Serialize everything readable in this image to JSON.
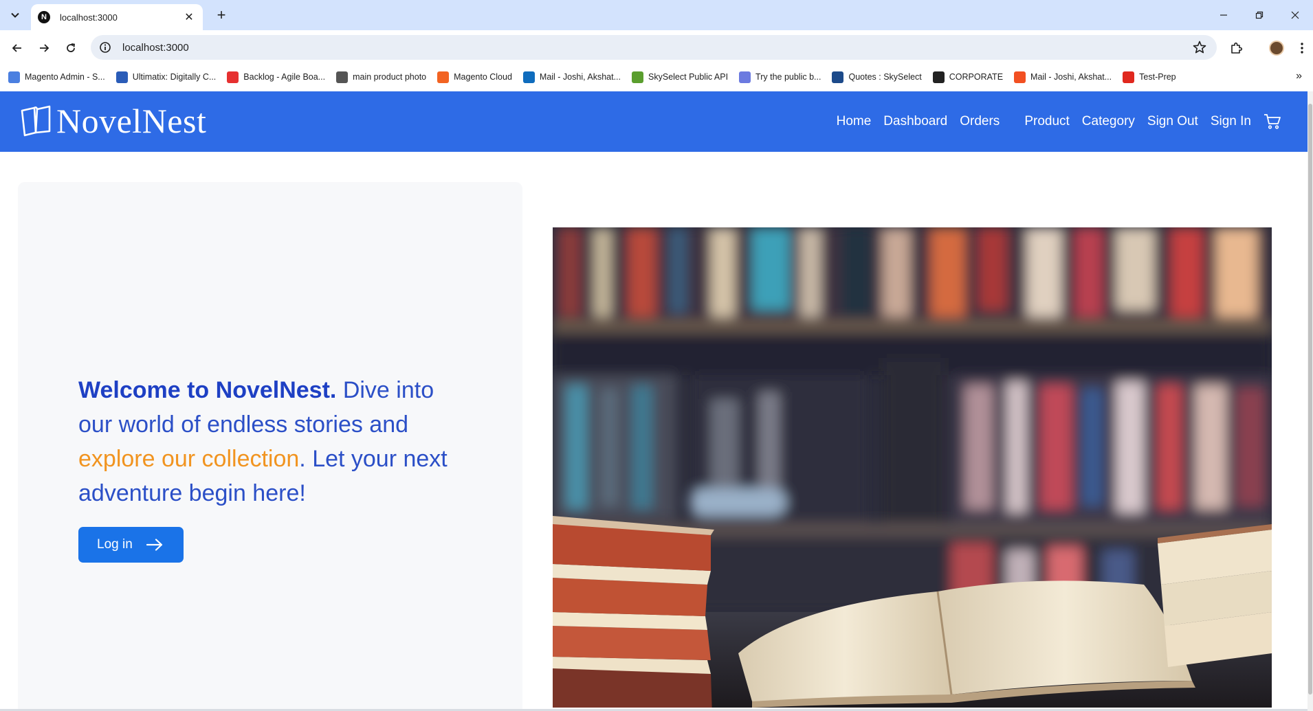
{
  "browser": {
    "tab_title": "localhost:3000",
    "favicon_letter": "N",
    "url": "localhost:3000"
  },
  "bookmarks": [
    {
      "label": "Magento Admin - S...",
      "icon": "magento-admin-icon",
      "color": "#4a7fe0"
    },
    {
      "label": "Ultimatix: Digitally C...",
      "icon": "ultimatix-icon",
      "color": "#2a5cb8"
    },
    {
      "label": "Backlog - Agile Boa...",
      "icon": "backlog-icon",
      "color": "#e63030"
    },
    {
      "label": "main product photo",
      "icon": "globe-icon",
      "color": "#555555"
    },
    {
      "label": "Magento Cloud",
      "icon": "magento-cloud-icon",
      "color": "#f26322"
    },
    {
      "label": "Mail - Joshi, Akshat...",
      "icon": "outlook-icon",
      "color": "#0f6cbd"
    },
    {
      "label": "SkySelect Public API",
      "icon": "skyselect-api-icon",
      "color": "#5a9e2e"
    },
    {
      "label": "Try the public b...",
      "icon": "try-public-icon",
      "color": "#6b7ae0"
    },
    {
      "label": "Quotes : SkySelect",
      "icon": "skyselect-quotes-icon",
      "color": "#1c4a8a"
    },
    {
      "label": "CORPORATE",
      "icon": "corporate-icon",
      "color": "#222222"
    },
    {
      "label": "Mail - Joshi, Akshat...",
      "icon": "microsoft-icon",
      "color": "#f25022"
    },
    {
      "label": "Test-Prep",
      "icon": "test-prep-icon",
      "color": "#e0281e"
    }
  ],
  "site": {
    "logo_text": "NovelNest",
    "nav": {
      "home": "Home",
      "dashboard": "Dashboard",
      "orders": "Orders",
      "product": "Product",
      "category": "Category",
      "sign_out": "Sign Out",
      "sign_in": "Sign In"
    },
    "hero": {
      "heading_strong": "Welcome to NovelNest.",
      "heading_part1": " Dive into our world of endless stories and ",
      "heading_accent": "explore our collection",
      "heading_part2": ". Let your next adventure begin here!",
      "login_label": "Log in"
    },
    "colors": {
      "header_bg": "#2e6be6",
      "hero_text": "#2b4fc7",
      "accent": "#f19420",
      "button": "#1a73e8"
    }
  }
}
